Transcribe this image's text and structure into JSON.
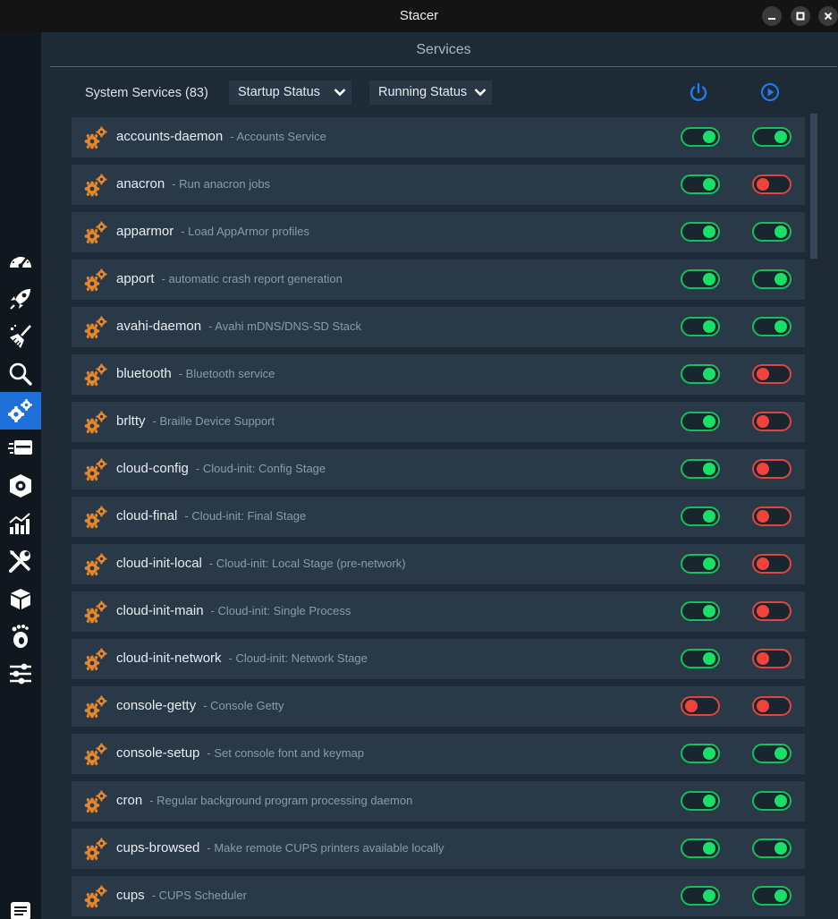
{
  "window": {
    "title": "Stacer"
  },
  "sidebar": {
    "items": [
      {
        "icon": "dashboard-icon"
      },
      {
        "icon": "startup-apps-rocket-icon"
      },
      {
        "icon": "system-cleaner-broom-icon"
      },
      {
        "icon": "search-icon"
      },
      {
        "icon": "services-gears-icon",
        "active": true
      },
      {
        "icon": "processes-icon"
      },
      {
        "icon": "uninstaller-icon"
      },
      {
        "icon": "resources-chart-icon"
      },
      {
        "icon": "helpers-tools-icon"
      },
      {
        "icon": "apt-repository-box-icon"
      },
      {
        "icon": "gnome-settings-foot-icon"
      },
      {
        "icon": "settings-sliders-icon"
      },
      {
        "icon": "feedback-icon"
      }
    ]
  },
  "page": {
    "title": "Services"
  },
  "toolbar": {
    "count_label": "System Services (83)",
    "startup_filter": "Startup Status",
    "running_filter": "Running Status",
    "startup_header_icon": "power-icon",
    "running_header_icon": "play-icon"
  },
  "colors": {
    "accent": "#1e6fd8",
    "on": "#1be068",
    "off": "#f0443a",
    "gear": "#e8862a"
  },
  "services": [
    {
      "name": "accounts-daemon",
      "description": "- Accounts Service",
      "startup": true,
      "running": true
    },
    {
      "name": "anacron",
      "description": "- Run anacron jobs",
      "startup": true,
      "running": false
    },
    {
      "name": "apparmor",
      "description": "- Load AppArmor profiles",
      "startup": true,
      "running": true
    },
    {
      "name": "apport",
      "description": "- automatic crash report generation",
      "startup": true,
      "running": true
    },
    {
      "name": "avahi-daemon",
      "description": "- Avahi mDNS/DNS-SD Stack",
      "startup": true,
      "running": true
    },
    {
      "name": "bluetooth",
      "description": "- Bluetooth service",
      "startup": true,
      "running": false
    },
    {
      "name": "brltty",
      "description": "- Braille Device Support",
      "startup": true,
      "running": false
    },
    {
      "name": "cloud-config",
      "description": "- Cloud-init: Config Stage",
      "startup": true,
      "running": false
    },
    {
      "name": "cloud-final",
      "description": "- Cloud-init: Final Stage",
      "startup": true,
      "running": false
    },
    {
      "name": "cloud-init-local",
      "description": "- Cloud-init: Local Stage (pre-network)",
      "startup": true,
      "running": false
    },
    {
      "name": "cloud-init-main",
      "description": "- Cloud-init: Single Process",
      "startup": true,
      "running": false
    },
    {
      "name": "cloud-init-network",
      "description": "- Cloud-init: Network Stage",
      "startup": true,
      "running": false
    },
    {
      "name": "console-getty",
      "description": "- Console Getty",
      "startup": false,
      "running": false
    },
    {
      "name": "console-setup",
      "description": "- Set console font and keymap",
      "startup": true,
      "running": true
    },
    {
      "name": "cron",
      "description": "- Regular background program processing daemon",
      "startup": true,
      "running": true
    },
    {
      "name": "cups-browsed",
      "description": "- Make remote CUPS printers available locally",
      "startup": true,
      "running": true
    },
    {
      "name": "cups",
      "description": "- CUPS Scheduler",
      "startup": true,
      "running": true
    }
  ]
}
